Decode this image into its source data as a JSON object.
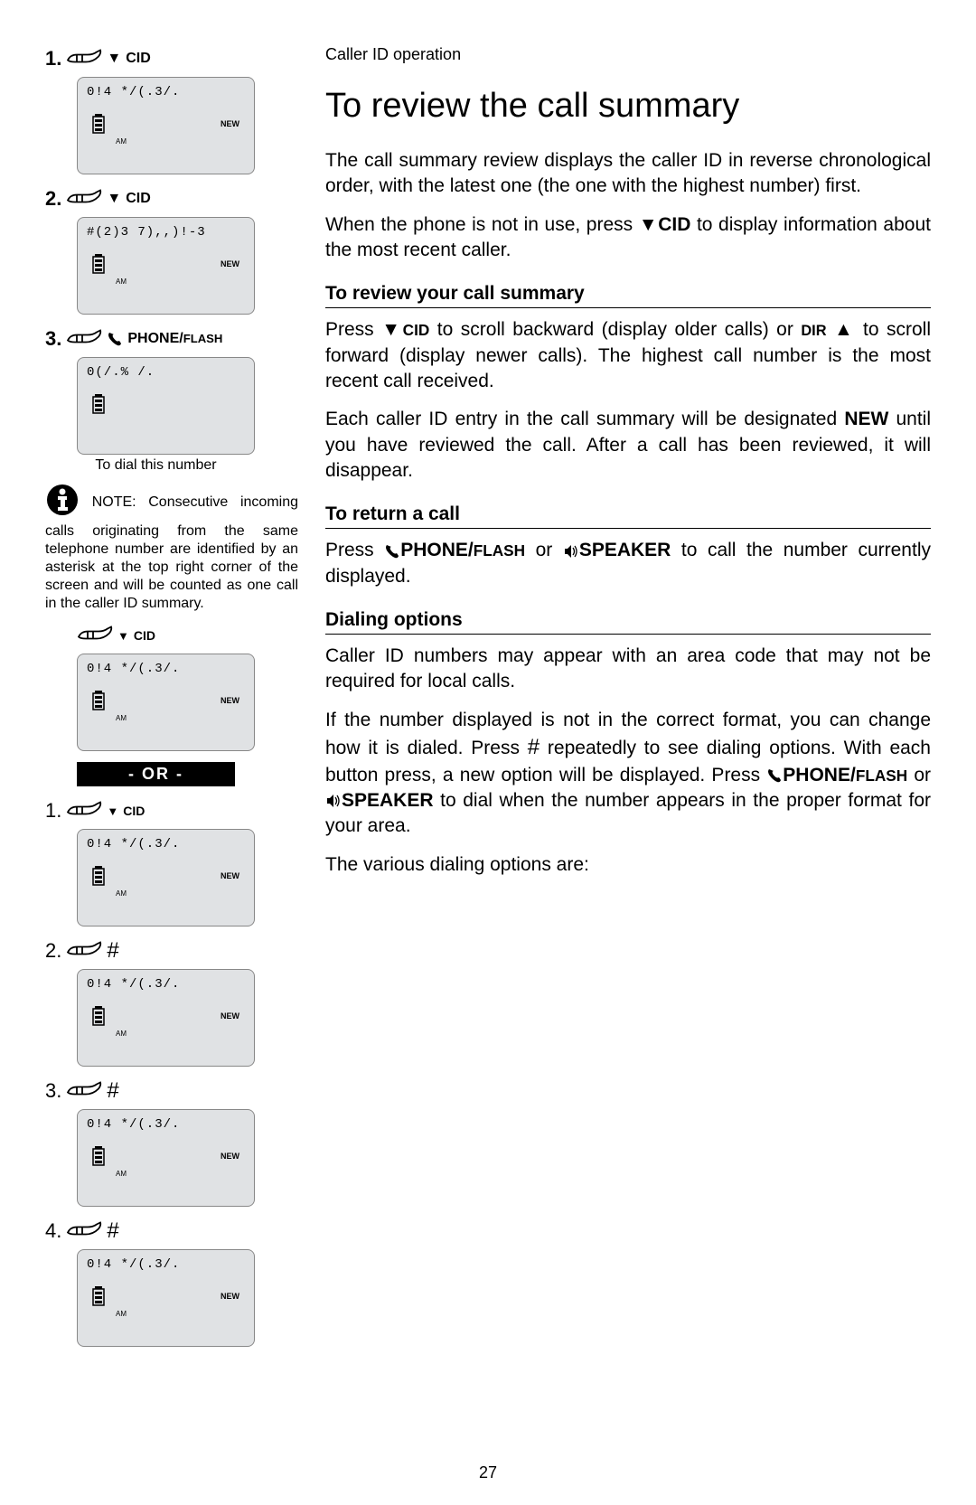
{
  "breadcrumb": "Caller ID operation",
  "title": "To review the call summary",
  "intro1": "The call summary review displays the caller ID in reverse chronological order, with the latest one (the one with the highest number) first.",
  "intro2_a": "When the phone is not in use, press ",
  "intro2_cid": "CID",
  "intro2_b": " to display information about the most recent caller.",
  "sub1": "To review your call summary",
  "s1p_a": "Press ",
  "s1p_cid": "CID",
  "s1p_b": " to scroll backward (display older calls) or ",
  "s1p_dir": "DIR",
  "s1p_c": " to scroll forward (display newer calls). The highest call number is the most recent call received.",
  "s1p2_a": "Each caller ID entry in the call summary will be designated ",
  "s1p2_new": "NEW",
  "s1p2_b": " until you have reviewed the call. After a call has been reviewed, it will disappear.",
  "sub2": "To return a call",
  "s2p_a": "Press ",
  "s2p_phone": "PHONE/",
  "s2p_flash": "FLASH",
  "s2p_b": " or ",
  "s2p_speaker": "SPEAKER",
  "s2p_c": " to call the number currently displayed.",
  "sub3": "Dialing options",
  "s3p1": "Caller ID numbers may appear with an area code that may not be required for local calls.",
  "s3p2_a": "If the number displayed is not in the correct format, you can change how it is dialed. Press ",
  "s3p2_hash": "#",
  "s3p2_b": " repeatedly to see dialing options. With each button press, a new option will be displayed. Press ",
  "s3p2_phone": "PHONE/",
  "s3p2_flash": "FLASH",
  "s3p2_c": " or ",
  "s3p2_speaker": "SPEAKER",
  "s3p2_d": " to dial when the number appears in the proper format for your area.",
  "s3p3": "The various dialing options are:",
  "page_number": "27",
  "left": {
    "s1": {
      "num": "1.",
      "btn": "CID",
      "line": "0!4 */(.3/.",
      "new": "NEW",
      "am": "AM"
    },
    "s2": {
      "num": "2.",
      "btn": "CID",
      "line": "#(2)3 7),,)!-3",
      "new": "NEW",
      "am": "AM"
    },
    "s3": {
      "num": "3.",
      "btn": "PHONE/",
      "btn2": "FLASH",
      "line": "0(/.% /.",
      "caption": "To dial this number"
    },
    "note_label": "NOTE:",
    "note_text": " Consecutive incoming calls originating from the same telephone number are identified by an asterisk at the top right corner of the screen and will be counted as one call in the caller ID summary.",
    "b0": {
      "btn": "CID",
      "line": "0!4 */(.3/.",
      "new": "NEW",
      "am": "AM"
    },
    "or": "- OR -",
    "b1": {
      "num": "1.",
      "btn": "CID",
      "line": "0!4 */(.3/.",
      "new": "NEW",
      "am": "AM"
    },
    "b2": {
      "num": "2.",
      "btn": "#",
      "line": "0!4 */(.3/.",
      "new": "NEW",
      "am": "AM"
    },
    "b3": {
      "num": "3.",
      "btn": "#",
      "line": "0!4 */(.3/.",
      "new": "NEW",
      "am": "AM"
    },
    "b4": {
      "num": "4.",
      "btn": "#",
      "line": "0!4 */(.3/.",
      "new": "NEW",
      "am": "AM"
    }
  }
}
